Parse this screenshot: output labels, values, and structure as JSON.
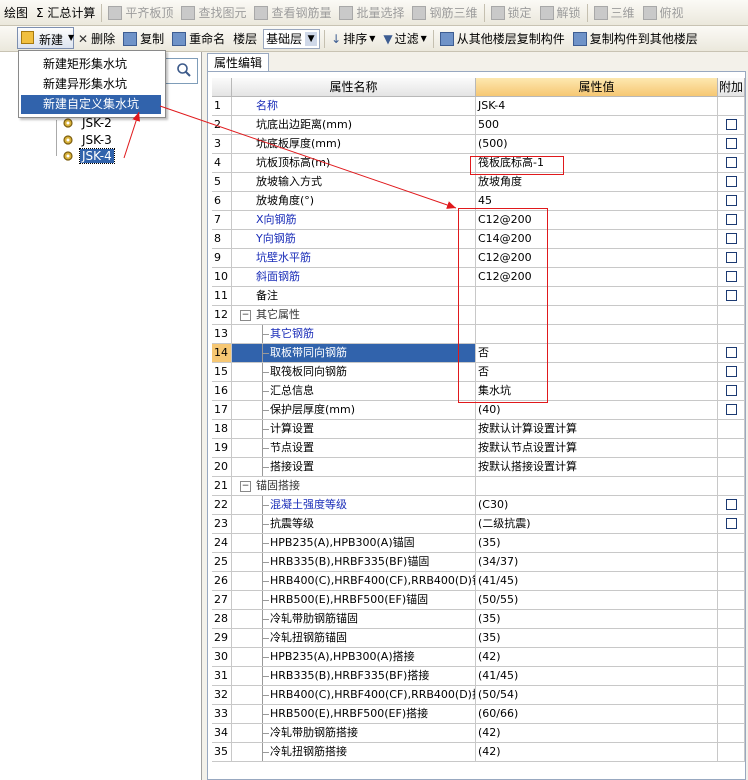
{
  "toolbar1": {
    "items": [
      {
        "label": "绘图",
        "state": "enabled",
        "icon": "draw-icon"
      },
      {
        "label": "Σ 汇总计算",
        "state": "enabled",
        "icon": "sum-icon"
      },
      {
        "label": "平齐板顶",
        "state": "disabled",
        "icon": "align-top-icon"
      },
      {
        "label": "查找图元",
        "state": "disabled",
        "icon": "find-element-icon"
      },
      {
        "label": "查看钢筋量",
        "state": "disabled",
        "icon": "rebar-qty-icon"
      },
      {
        "label": "批量选择",
        "state": "disabled",
        "icon": "batch-select-icon"
      },
      {
        "label": "钢筋三维",
        "state": "disabled",
        "icon": "rebar-3d-icon"
      },
      {
        "label": "锁定",
        "state": "disabled",
        "icon": "lock-icon"
      },
      {
        "label": "解锁",
        "state": "disabled",
        "icon": "unlock-icon"
      },
      {
        "label": "三维",
        "state": "disabled",
        "icon": "cube-icon"
      },
      {
        "label": "俯视",
        "state": "disabled",
        "icon": "top-view-icon"
      }
    ]
  },
  "toolbar2": {
    "new_label": "新建",
    "delete_label": "删除",
    "copy_label": "复制",
    "rename_label": "重命名",
    "floor_label": "楼层",
    "floor_value": "基础层",
    "sort_label": "排序",
    "filter_label": "过滤",
    "copy_from_label": "从其他楼层复制构件",
    "copy_to_label": "复制构件到其他楼层"
  },
  "new_menu": {
    "items": [
      "新建矩形集水坑",
      "新建异形集水坑",
      "新建自定义集水坑"
    ],
    "highlighted_index": 2
  },
  "tree": {
    "items": [
      "JSK-2",
      "JSK-3",
      "JSK-4"
    ],
    "selected_index": 2
  },
  "tab": {
    "label": "属性编辑"
  },
  "grid": {
    "headers": {
      "name": "属性名称",
      "value": "属性值",
      "extra": "附加"
    },
    "rows": [
      {
        "num": "1",
        "name": "名称",
        "value": "JSK-4",
        "checkbox": false,
        "style": "blue"
      },
      {
        "num": "2",
        "name": "坑底出边距离(mm)",
        "value": "500",
        "checkbox": true,
        "style": ""
      },
      {
        "num": "3",
        "name": "坑底板厚度(mm)",
        "value": "(500)",
        "checkbox": true,
        "style": ""
      },
      {
        "num": "4",
        "name": "坑板顶标高(m)",
        "value": "筏板底标高-1",
        "checkbox": true,
        "style": ""
      },
      {
        "num": "5",
        "name": "放坡输入方式",
        "value": "放坡角度",
        "checkbox": true,
        "style": ""
      },
      {
        "num": "6",
        "name": "放坡角度(°)",
        "value": "45",
        "checkbox": true,
        "style": ""
      },
      {
        "num": "7",
        "name": "X向钢筋",
        "value": "C12@200",
        "checkbox": true,
        "style": "blue"
      },
      {
        "num": "8",
        "name": "Y向钢筋",
        "value": "C14@200",
        "checkbox": true,
        "style": "blue"
      },
      {
        "num": "9",
        "name": "坑壁水平筋",
        "value": "C12@200",
        "checkbox": true,
        "style": "blue"
      },
      {
        "num": "10",
        "name": "斜面钢筋",
        "value": "C12@200",
        "checkbox": true,
        "style": "blue"
      },
      {
        "num": "11",
        "name": "备注",
        "value": "",
        "checkbox": true,
        "style": ""
      },
      {
        "num": "12",
        "name": "其它属性",
        "value": "",
        "checkbox": false,
        "style": "group"
      },
      {
        "num": "13",
        "name": "其它钢筋",
        "value": "",
        "checkbox": false,
        "style": "tree blue"
      },
      {
        "num": "14",
        "name": "取板带同向钢筋",
        "value": "否",
        "checkbox": true,
        "style": "tree sel"
      },
      {
        "num": "15",
        "name": "取筏板同向钢筋",
        "value": "否",
        "checkbox": true,
        "style": "tree"
      },
      {
        "num": "16",
        "name": "汇总信息",
        "value": "集水坑",
        "checkbox": true,
        "style": "tree"
      },
      {
        "num": "17",
        "name": "保护层厚度(mm)",
        "value": "(40)",
        "checkbox": true,
        "style": "tree"
      },
      {
        "num": "18",
        "name": "计算设置",
        "value": "按默认计算设置计算",
        "checkbox": false,
        "style": "tree"
      },
      {
        "num": "19",
        "name": "节点设置",
        "value": "按默认节点设置计算",
        "checkbox": false,
        "style": "tree"
      },
      {
        "num": "20",
        "name": "搭接设置",
        "value": "按默认搭接设置计算",
        "checkbox": false,
        "style": "tree"
      },
      {
        "num": "21",
        "name": "锚固搭接",
        "value": "",
        "checkbox": false,
        "style": "group"
      },
      {
        "num": "22",
        "name": "混凝土强度等级",
        "value": "(C30)",
        "checkbox": true,
        "style": "tree blue"
      },
      {
        "num": "23",
        "name": "抗震等级",
        "value": "(二级抗震)",
        "checkbox": true,
        "style": "tree"
      },
      {
        "num": "24",
        "name": "HPB235(A),HPB300(A)锚固",
        "value": "(35)",
        "checkbox": false,
        "style": "tree"
      },
      {
        "num": "25",
        "name": "HRB335(B),HRBF335(BF)锚固",
        "value": "(34/37)",
        "checkbox": false,
        "style": "tree"
      },
      {
        "num": "26",
        "name": "HRB400(C),HRBF400(CF),RRB400(D)锚",
        "value": "(41/45)",
        "checkbox": false,
        "style": "tree"
      },
      {
        "num": "27",
        "name": "HRB500(E),HRBF500(EF)锚固",
        "value": "(50/55)",
        "checkbox": false,
        "style": "tree"
      },
      {
        "num": "28",
        "name": "冷轧带肋钢筋锚固",
        "value": "(35)",
        "checkbox": false,
        "style": "tree"
      },
      {
        "num": "29",
        "name": "冷轧扭钢筋锚固",
        "value": "(35)",
        "checkbox": false,
        "style": "tree"
      },
      {
        "num": "30",
        "name": "HPB235(A),HPB300(A)搭接",
        "value": "(42)",
        "checkbox": false,
        "style": "tree"
      },
      {
        "num": "31",
        "name": "HRB335(B),HRBF335(BF)搭接",
        "value": "(41/45)",
        "checkbox": false,
        "style": "tree"
      },
      {
        "num": "32",
        "name": "HRB400(C),HRBF400(CF),RRB400(D)搭",
        "value": "(50/54)",
        "checkbox": false,
        "style": "tree"
      },
      {
        "num": "33",
        "name": "HRB500(E),HRBF500(EF)搭接",
        "value": "(60/66)",
        "checkbox": false,
        "style": "tree"
      },
      {
        "num": "34",
        "name": "冷轧带肋钢筋搭接",
        "value": "(42)",
        "checkbox": false,
        "style": "tree"
      },
      {
        "num": "35",
        "name": "冷轧扭钢筋搭接",
        "value": "(42)",
        "checkbox": false,
        "style": "tree"
      }
    ]
  },
  "colors": {
    "selection": "#3163ac",
    "annotation": "#e0191c",
    "header_value": "#f6c773",
    "blue_text": "#1a2db8"
  }
}
